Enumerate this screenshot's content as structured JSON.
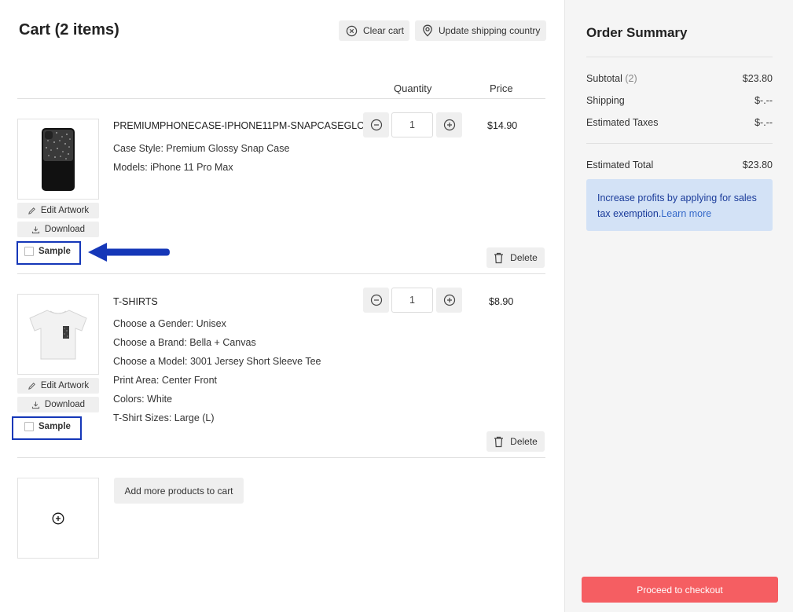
{
  "cart": {
    "title": "Cart (2 items)",
    "clear_label": "Clear cart",
    "shipping_label": "Update shipping country",
    "col_quantity": "Quantity",
    "col_price": "Price"
  },
  "items": [
    {
      "title": "PREMIUMPHONECASE-IPHONE11PM-SNAPCASEGLOSSY",
      "attrs": [
        "Case Style: Premium Glossy Snap Case",
        "Models: iPhone 11 Pro Max"
      ],
      "quantity": "1",
      "price": "$14.90",
      "edit_label": "Edit Artwork",
      "download_label": "Download",
      "sample_label": "Sample",
      "delete_label": "Delete"
    },
    {
      "title": "T-SHIRTS",
      "attrs": [
        "Choose a Gender: Unisex",
        "Choose a Brand: Bella + Canvas",
        "Choose a Model: 3001 Jersey Short Sleeve Tee",
        "Print Area: Center Front",
        "Colors: White",
        "T-Shirt Sizes: Large (L)"
      ],
      "quantity": "1",
      "price": "$8.90",
      "edit_label": "Edit Artwork",
      "download_label": "Download",
      "sample_label": "Sample",
      "delete_label": "Delete"
    }
  ],
  "add_more_label": "Add more products to cart",
  "summary": {
    "title": "Order Summary",
    "subtotal_label": "Subtotal",
    "subtotal_count": "(2)",
    "subtotal_value": "$23.80",
    "shipping_label": "Shipping",
    "shipping_value": "$-.--",
    "taxes_label": "Estimated Taxes",
    "taxes_value": "$-.--",
    "total_label": "Estimated Total",
    "total_value": "$23.80",
    "info_text": "Increase profits by applying for sales tax exemption.",
    "info_link": "Learn more",
    "checkout_label": "Proceed to checkout"
  },
  "colors": {
    "highlight": "#1537b8",
    "checkout": "#f55e62",
    "info_bg": "#d3e2f6"
  }
}
